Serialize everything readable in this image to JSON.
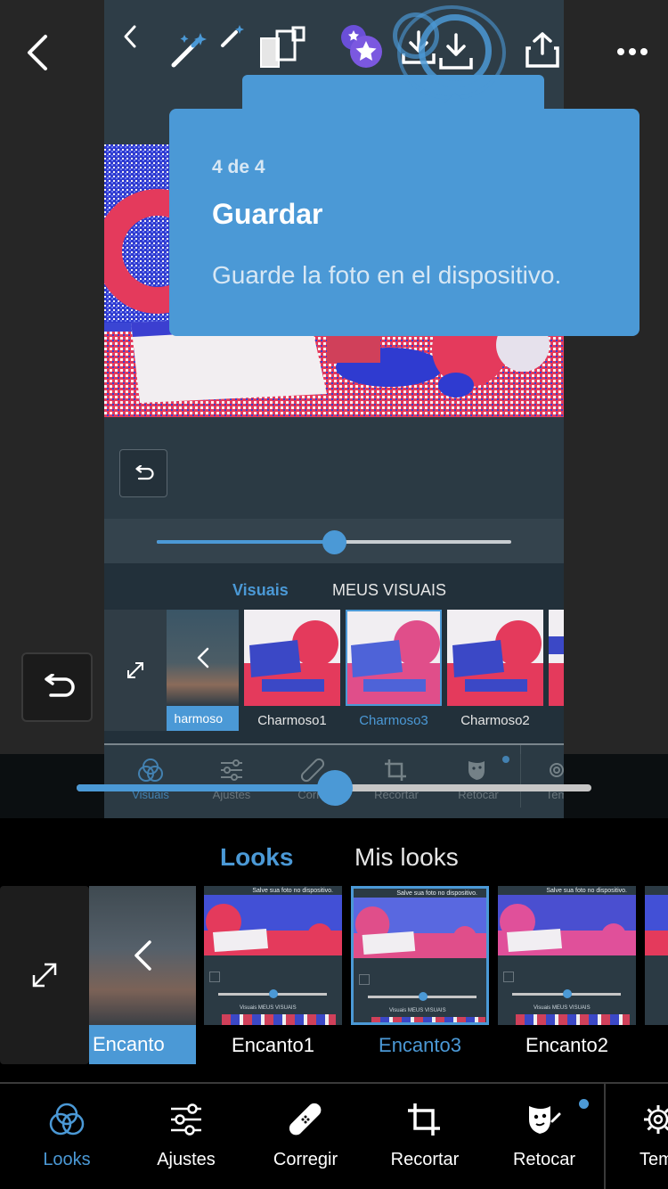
{
  "tooltip": {
    "step": "4 de 4",
    "title": "Guardar",
    "body": "Guarde la foto en el dispositivo."
  },
  "inner": {
    "tabs": [
      "Visuais",
      "MEUS VISUAIS"
    ],
    "looks_strip": {
      "first_label": "harmoso",
      "items": [
        "Charmoso1",
        "Charmoso3",
        "Charmoso2"
      ],
      "selected": "Charmoso3"
    },
    "toolbar": [
      "Visuais",
      "Ajustes",
      "Corrig",
      "Recortar",
      "Retocar",
      "Tem"
    ]
  },
  "looks_tabs": {
    "active": "Looks",
    "other": "Mis looks"
  },
  "looks": {
    "first_label": "Encanto",
    "items": [
      "Encanto1",
      "Encanto3",
      "Encanto2"
    ],
    "selected": "Encanto3",
    "thumb_caption": "Salve sua foto no dispositivo.",
    "thumb_tabs": "Visuais   MEUS VISUAIS"
  },
  "bottom_bar": {
    "items": [
      "Looks",
      "Ajustes",
      "Corregir",
      "Recortar",
      "Retocar",
      "Tem"
    ],
    "active": "Looks"
  },
  "colors": {
    "accent": "#4b99d6",
    "outer_bg": "#262626",
    "inner_bg": "#2b3a44"
  },
  "sliders": {
    "outer_value": 0.5,
    "inner_value": 0.5
  }
}
